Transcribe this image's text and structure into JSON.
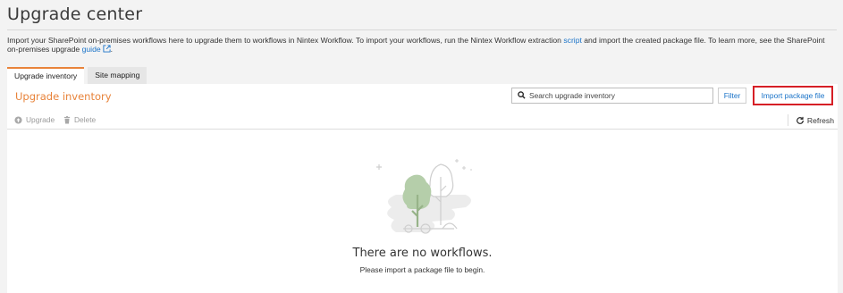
{
  "page": {
    "title": "Upgrade center"
  },
  "intro": {
    "text1": "Import your SharePoint on-premises workflows here to upgrade them to workflows in Nintex Workflow. To import your workflows, run the Nintex Workflow extraction ",
    "script_link": "script",
    "text2": " and import the created package file. To learn more, see the SharePoint on-premises upgrade ",
    "guide_link": "guide",
    "text3": "."
  },
  "tabs": [
    {
      "label": "Upgrade inventory",
      "active": true
    },
    {
      "label": "Site mapping",
      "active": false
    }
  ],
  "inventory": {
    "title": "Upgrade inventory",
    "search_placeholder": "Search upgrade inventory",
    "filter_label": "Filter",
    "import_label": "Import package file"
  },
  "toolbar": {
    "upgrade_label": "Upgrade",
    "delete_label": "Delete",
    "refresh_label": "Refresh"
  },
  "empty_state": {
    "title": "There are no workflows.",
    "subtitle": "Please import a package file to begin."
  },
  "colors": {
    "accent": "#e8833a",
    "link": "#1a73c8",
    "highlight": "#d61f26",
    "illustration": "#b5ceaa"
  },
  "icons": [
    "search-icon",
    "upgrade-icon",
    "trash-icon",
    "refresh-icon",
    "external-link-icon"
  ]
}
